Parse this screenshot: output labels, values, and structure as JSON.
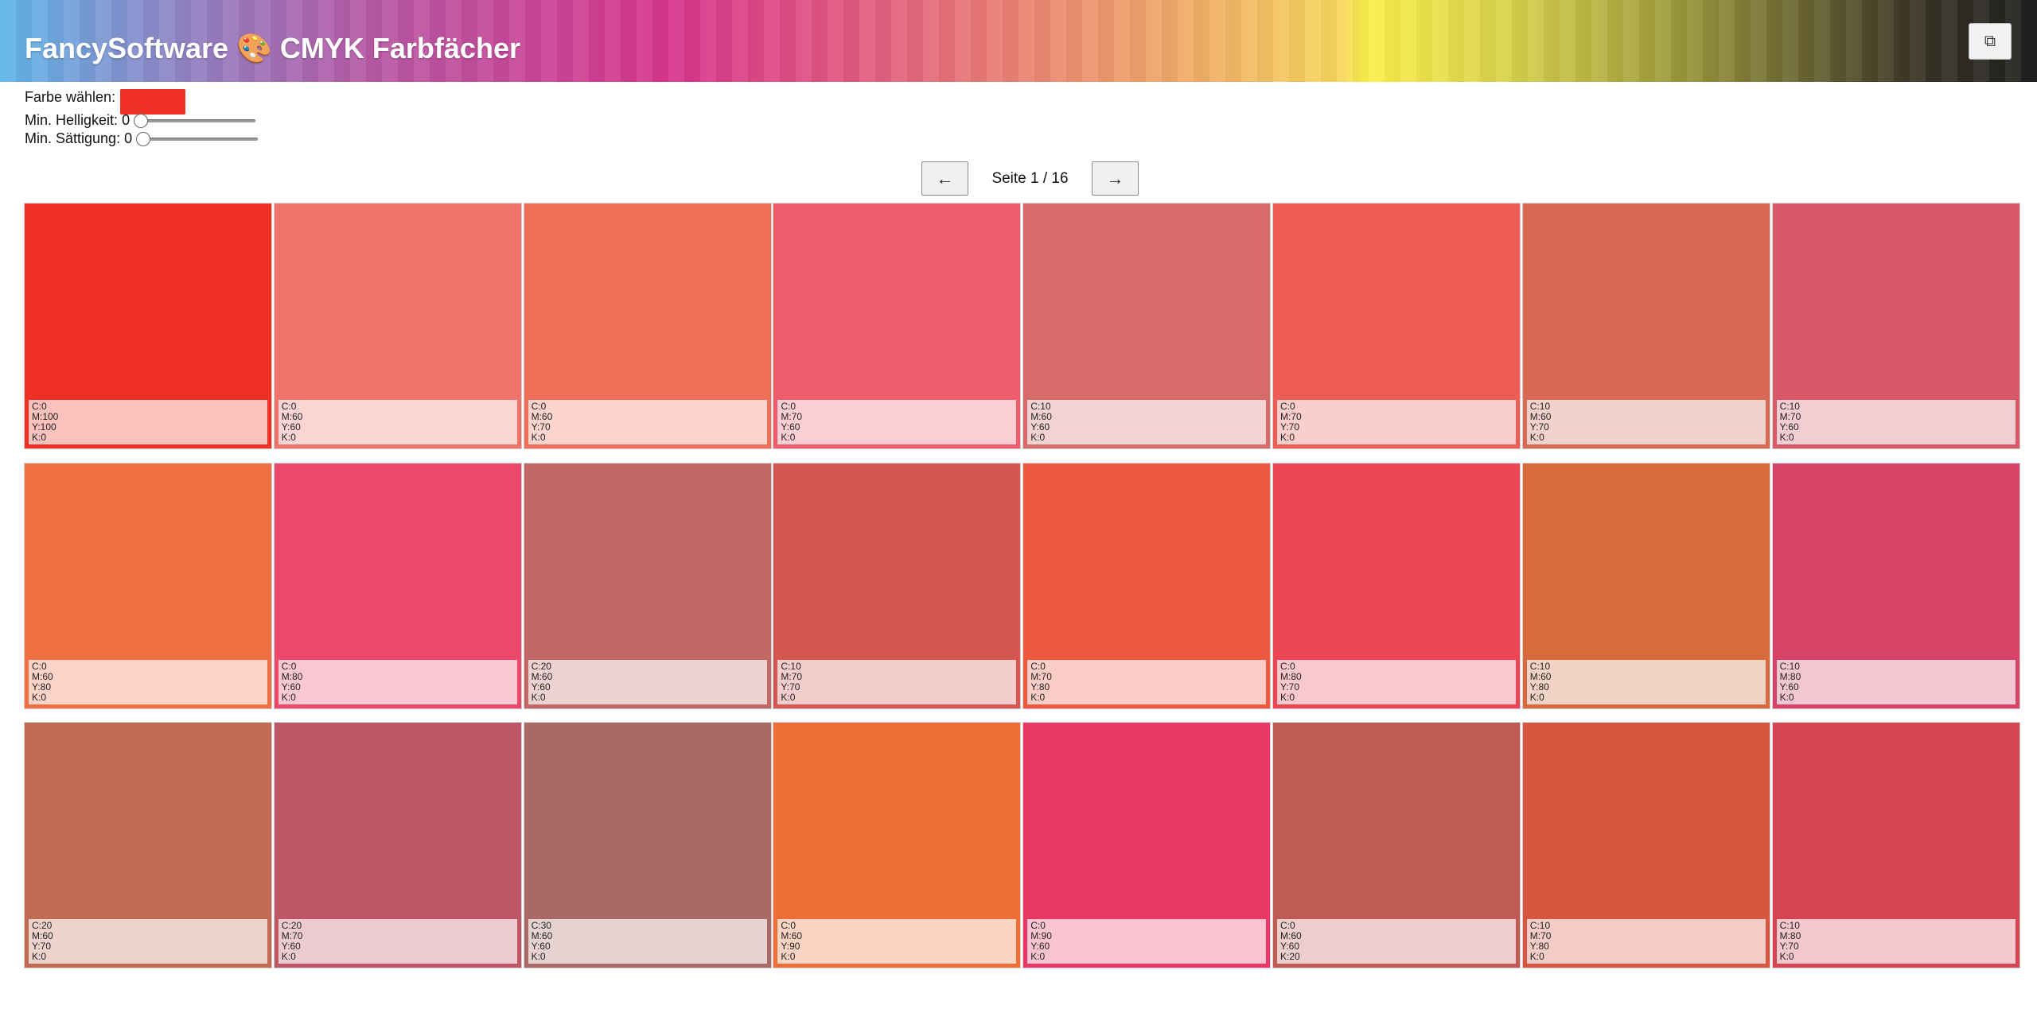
{
  "header": {
    "title": "FancySoftware 🎨 CMYK Farbfächer",
    "copy_icon": "⧉"
  },
  "controls": {
    "color_label": "Farbe wählen:",
    "selected_color": "#ee3124",
    "brightness_label": "Min. Helligkeit:",
    "brightness_value": "0",
    "saturation_label": "Min. Sättigung:",
    "saturation_value": "0"
  },
  "pager": {
    "prev_icon": "←",
    "label": "Seite 1 / 16",
    "next_icon": "→"
  },
  "swatches": [
    {
      "c": "C:0",
      "m": "M:100",
      "y": "Y:100",
      "k": "K:0",
      "color": "#ee3124"
    },
    {
      "c": "C:0",
      "m": "M:60",
      "y": "Y:60",
      "k": "K:0",
      "color": "#ef736b"
    },
    {
      "c": "C:0",
      "m": "M:60",
      "y": "Y:70",
      "k": "K:0",
      "color": "#ef6e58"
    },
    {
      "c": "C:0",
      "m": "M:70",
      "y": "Y:60",
      "k": "K:0",
      "color": "#ee5d6b"
    },
    {
      "c": "C:10",
      "m": "M:60",
      "y": "Y:60",
      "k": "K:0",
      "color": "#d76b69"
    },
    {
      "c": "C:0",
      "m": "M:70",
      "y": "Y:70",
      "k": "K:0",
      "color": "#ee5c56"
    },
    {
      "c": "C:10",
      "m": "M:60",
      "y": "Y:70",
      "k": "K:0",
      "color": "#d86a54"
    },
    {
      "c": "C:10",
      "m": "M:70",
      "y": "Y:60",
      "k": "K:0",
      "color": "#d75867"
    },
    {
      "c": "C:0",
      "m": "M:60",
      "y": "Y:80",
      "k": "K:0",
      "color": "#f07044"
    },
    {
      "c": "C:0",
      "m": "M:80",
      "y": "Y:60",
      "k": "K:0",
      "color": "#ec486b"
    },
    {
      "c": "C:20",
      "m": "M:60",
      "y": "Y:60",
      "k": "K:0",
      "color": "#c26967"
    },
    {
      "c": "C:10",
      "m": "M:70",
      "y": "Y:70",
      "k": "K:0",
      "color": "#d65752"
    },
    {
      "c": "C:0",
      "m": "M:70",
      "y": "Y:80",
      "k": "K:0",
      "color": "#ed5a40"
    },
    {
      "c": "C:0",
      "m": "M:80",
      "y": "Y:70",
      "k": "K:0",
      "color": "#ec4656"
    },
    {
      "c": "C:10",
      "m": "M:60",
      "y": "Y:80",
      "k": "K:0",
      "color": "#d86b3e"
    },
    {
      "c": "C:10",
      "m": "M:80",
      "y": "Y:60",
      "k": "K:0",
      "color": "#d54467"
    },
    {
      "c": "C:20",
      "m": "M:60",
      "y": "Y:70",
      "k": "K:0",
      "color": "#c16b52"
    },
    {
      "c": "C:20",
      "m": "M:70",
      "y": "Y:60",
      "k": "K:0",
      "color": "#bf5665"
    },
    {
      "c": "C:30",
      "m": "M:60",
      "y": "Y:60",
      "k": "K:0",
      "color": "#a96a67"
    },
    {
      "c": "C:0",
      "m": "M:60",
      "y": "Y:90",
      "k": "K:0",
      "color": "#ee6e35"
    },
    {
      "c": "C:0",
      "m": "M:90",
      "y": "Y:60",
      "k": "K:0",
      "color": "#e93766"
    },
    {
      "c": "C:0",
      "m": "M:60",
      "y": "Y:60",
      "k": "K:20",
      "color": "#c05a55"
    },
    {
      "c": "C:10",
      "m": "M:70",
      "y": "Y:80",
      "k": "K:0",
      "color": "#d75640"
    },
    {
      "c": "C:10",
      "m": "M:80",
      "y": "Y:70",
      "k": "K:0",
      "color": "#d54451"
    }
  ]
}
